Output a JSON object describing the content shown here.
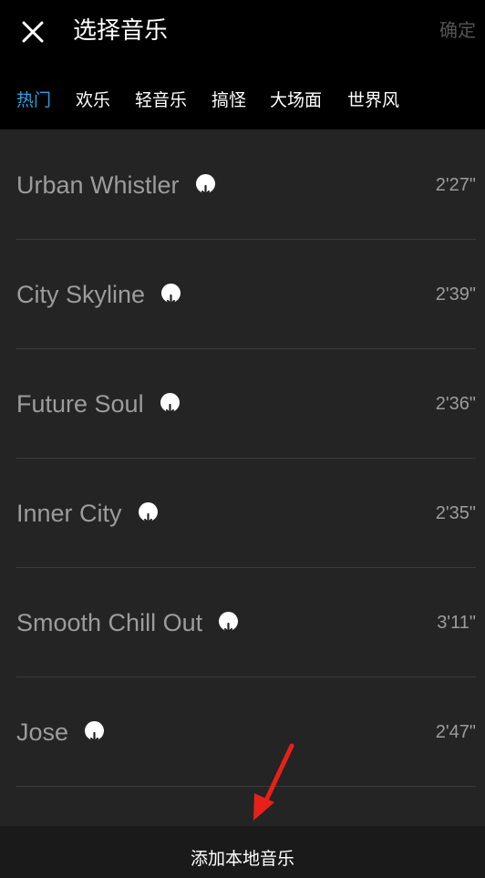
{
  "header": {
    "title": "选择音乐",
    "confirm_label": "确定",
    "close_icon": "close-icon"
  },
  "tabs": [
    {
      "label": "热门",
      "active": true
    },
    {
      "label": "欢乐",
      "active": false
    },
    {
      "label": "轻音乐",
      "active": false
    },
    {
      "label": "搞怪",
      "active": false
    },
    {
      "label": "大场面",
      "active": false
    },
    {
      "label": "世界风",
      "active": false
    }
  ],
  "tracks": [
    {
      "name": "Urban Whistler",
      "duration": "2'27\""
    },
    {
      "name": "City Skyline",
      "duration": "2'39\""
    },
    {
      "name": "Future Soul",
      "duration": "2'36\""
    },
    {
      "name": "Inner City",
      "duration": "2'35\""
    },
    {
      "name": "Smooth Chill Out",
      "duration": "3'11\""
    },
    {
      "name": "Jose",
      "duration": "2'47\""
    }
  ],
  "bottom": {
    "add_local_label": "添加本地音乐"
  },
  "colors": {
    "accent": "#22a3e8",
    "annotation_arrow": "#e8201a"
  }
}
